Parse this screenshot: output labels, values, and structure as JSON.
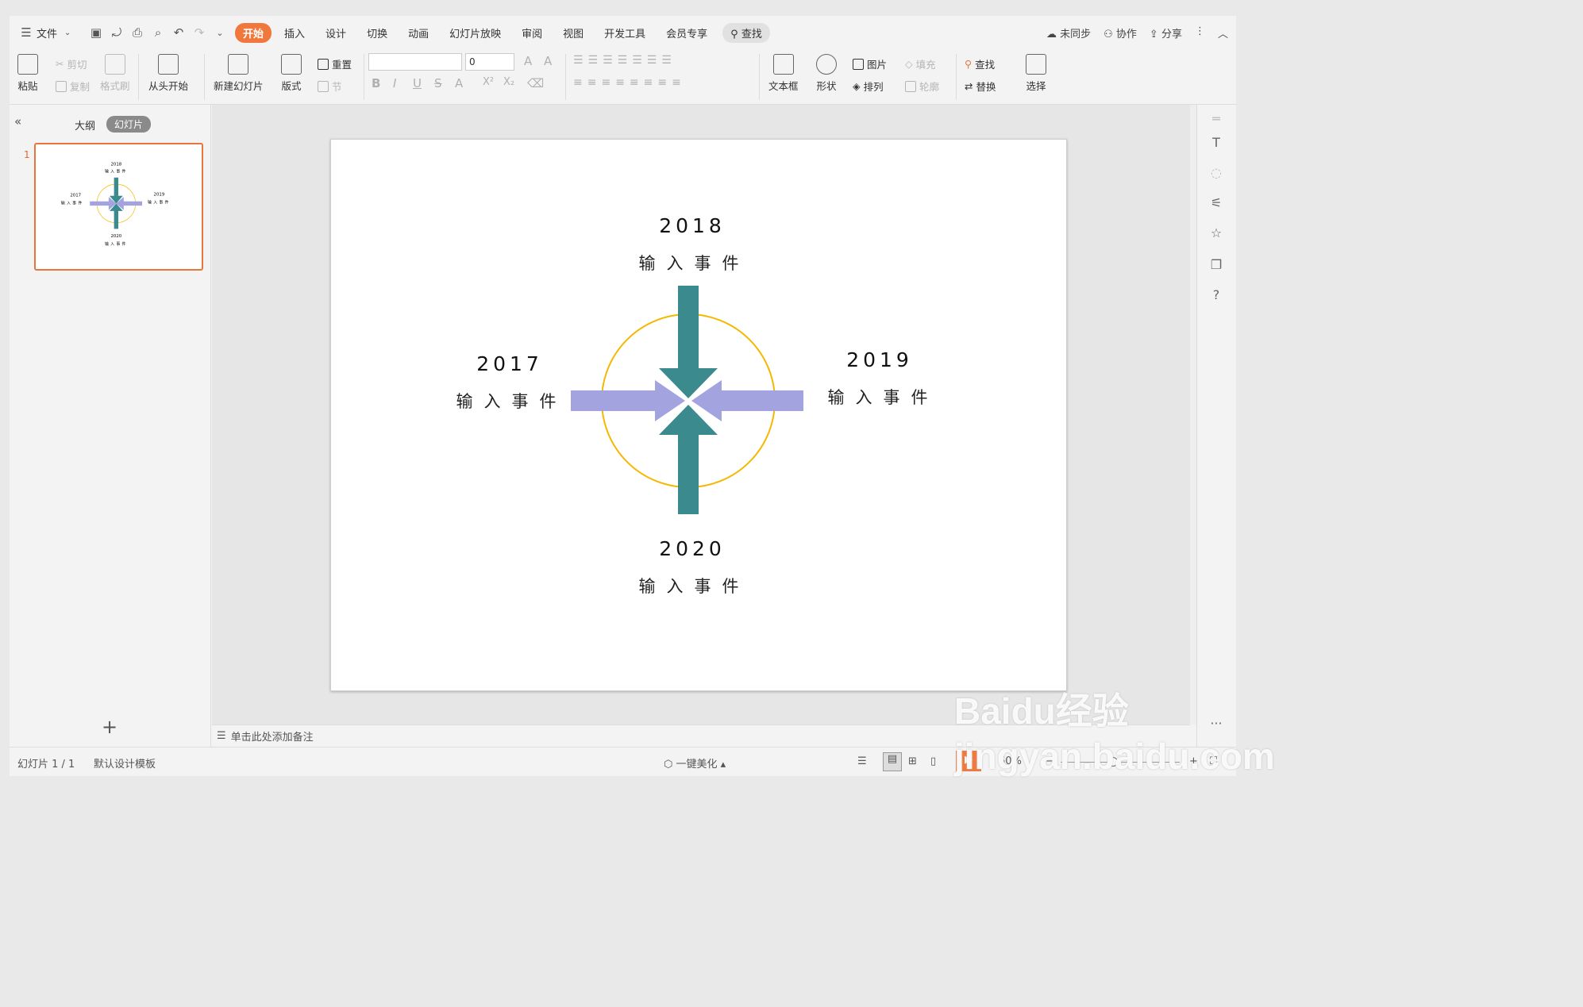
{
  "menu": {
    "file_label": "文件",
    "tabs": [
      "开始",
      "插入",
      "设计",
      "切换",
      "动画",
      "幻灯片放映",
      "审阅",
      "视图",
      "开发工具",
      "会员专享"
    ],
    "active_tab": "开始",
    "search_label": "查找",
    "right_actions": [
      "未同步",
      "协作",
      "分享"
    ]
  },
  "ribbon": {
    "paste": "粘贴",
    "cut": "剪切",
    "copy": "复制",
    "format_painter": "格式刷",
    "start_from_beginning": "从头开始",
    "new_slide": "新建幻灯片",
    "layout": "版式",
    "reset": "重置",
    "section": "节",
    "font_size_value": "0",
    "text_box": "文本框",
    "shapes": "形状",
    "picture": "图片",
    "fill": "填充",
    "arrange": "排列",
    "outline": "轮廓",
    "find": "查找",
    "replace": "替换",
    "select": "选择"
  },
  "left_panel": {
    "tab_outline": "大纲",
    "tab_slides": "幻灯片",
    "slide_number": "1",
    "add_button": "+"
  },
  "slide": {
    "events": [
      {
        "year": "2018",
        "label": "输入事件",
        "position": "top"
      },
      {
        "year": "2017",
        "label": "输入事件",
        "position": "left"
      },
      {
        "year": "2019",
        "label": "输入事件",
        "position": "right"
      },
      {
        "year": "2020",
        "label": "输入事件",
        "position": "bottom"
      }
    ],
    "colors": {
      "circle": "#f5b800",
      "vertical_arrows": "#3a8a8e",
      "horizontal_arrows": "#a3a3df"
    }
  },
  "notes_placeholder": "单击此处添加备注",
  "status": {
    "slide_counter": "幻灯片 1 / 1",
    "template": "默认设计模板",
    "beautify": "一键美化",
    "zoom": "60%"
  },
  "watermark": "Baidu经验 jingyan.baidu.com"
}
